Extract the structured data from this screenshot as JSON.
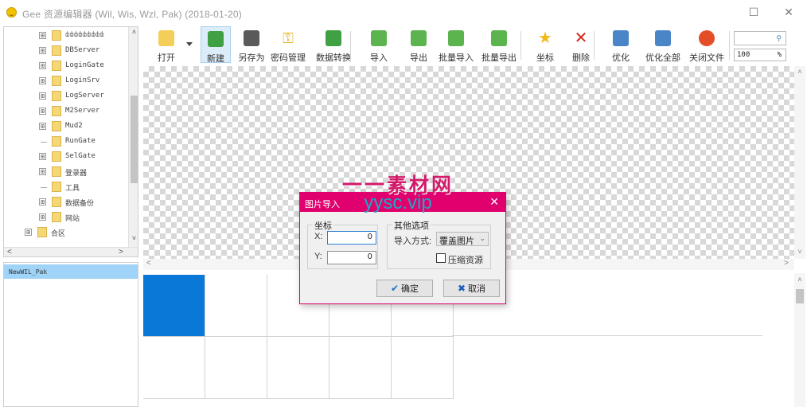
{
  "window": {
    "title": "Gee 资源编辑器 (Wil, Wis, Wzl, Pak) (2018-01-20)",
    "maximize_glyph": "☐",
    "close_glyph": "✕"
  },
  "tree": {
    "items": [
      {
        "label": "ȸȸȸȸȸȸȸȸȸ",
        "expander": "⊞",
        "has_expander": true
      },
      {
        "label": "DBServer",
        "expander": "⊞",
        "has_expander": true
      },
      {
        "label": "LoginGate",
        "expander": "⊞",
        "has_expander": true
      },
      {
        "label": "LoginSrv",
        "expander": "⊞",
        "has_expander": true
      },
      {
        "label": "LogServer",
        "expander": "⊞",
        "has_expander": true
      },
      {
        "label": "M2Server",
        "expander": "⊞",
        "has_expander": true
      },
      {
        "label": "Mud2",
        "expander": "⊞",
        "has_expander": true
      },
      {
        "label": "RunGate",
        "expander": "",
        "has_expander": false
      },
      {
        "label": "SelGate",
        "expander": "⊞",
        "has_expander": true
      },
      {
        "label": "登录器",
        "expander": "⊞",
        "has_expander": true
      },
      {
        "label": "工具",
        "expander": "",
        "has_expander": false
      },
      {
        "label": "数据备份",
        "expander": "⊞",
        "has_expander": true
      },
      {
        "label": "网站",
        "expander": "⊞",
        "has_expander": true
      },
      {
        "label": "合区",
        "expander": "⊞",
        "has_expander": true
      }
    ],
    "scroll_up": "˄",
    "scroll_down": "˅",
    "scroll_left": "<",
    "scroll_right": ">"
  },
  "file_list": {
    "selected": "NewWIL_Pak"
  },
  "toolbar": {
    "buttons": [
      {
        "label": "打开",
        "icon": "open-folder-icon",
        "color": "#f3cf5a"
      },
      {
        "label": "新建",
        "icon": "new-file-icon",
        "color": "#3fa143"
      },
      {
        "label": "另存为",
        "icon": "save-as-icon",
        "color": "#5a5a5a"
      },
      {
        "label": "密码管理",
        "icon": "key-icon",
        "color": "#e6b21e"
      },
      {
        "label": "数据转换",
        "icon": "convert-icon",
        "color": "#3fa143"
      },
      {
        "label": "导入",
        "icon": "import-icon",
        "color": "#5bb44e"
      },
      {
        "label": "导出",
        "icon": "export-icon",
        "color": "#5bb44e"
      },
      {
        "label": "批量导入",
        "icon": "batch-import-icon",
        "color": "#5bb44e"
      },
      {
        "label": "批量导出",
        "icon": "batch-export-icon",
        "color": "#5bb44e"
      },
      {
        "label": "坐标",
        "icon": "star-icon",
        "color": "#f2b81c"
      },
      {
        "label": "删除",
        "icon": "delete-icon",
        "color": "#d8261c"
      },
      {
        "label": "优化",
        "icon": "optimize-icon",
        "color": "#4a86c7"
      },
      {
        "label": "优化全部",
        "icon": "optimize-all-icon",
        "color": "#4a86c7"
      },
      {
        "label": "关闭文件",
        "icon": "close-file-icon",
        "color": "#e44d26"
      }
    ],
    "search_placeholder": "",
    "search_icon": "⚲",
    "zoom_value": "100",
    "zoom_unit": "%"
  },
  "canvas": {
    "scroll_up": "˄",
    "scroll_down": "˅",
    "scroll_left": "<",
    "scroll_right": ">"
  },
  "grid": {
    "scroll_up": "˄"
  },
  "dialog": {
    "title": "图片导入",
    "close_glyph": "✕",
    "coord_group": "坐标",
    "x_label": "X:",
    "x_value": "0",
    "y_label": "Y:",
    "y_value": "0",
    "options_group": "其他选项",
    "import_mode_label": "导入方式:",
    "import_mode_value": "覆盖图片",
    "compress_label": "压缩资源",
    "ok_label": "确定",
    "ok_icon": "✔",
    "cancel_label": "取消",
    "cancel_icon": "✖",
    "accent": "#e0006e"
  },
  "watermark": {
    "line1": "一一素材网",
    "line2": "yysc.vip"
  }
}
